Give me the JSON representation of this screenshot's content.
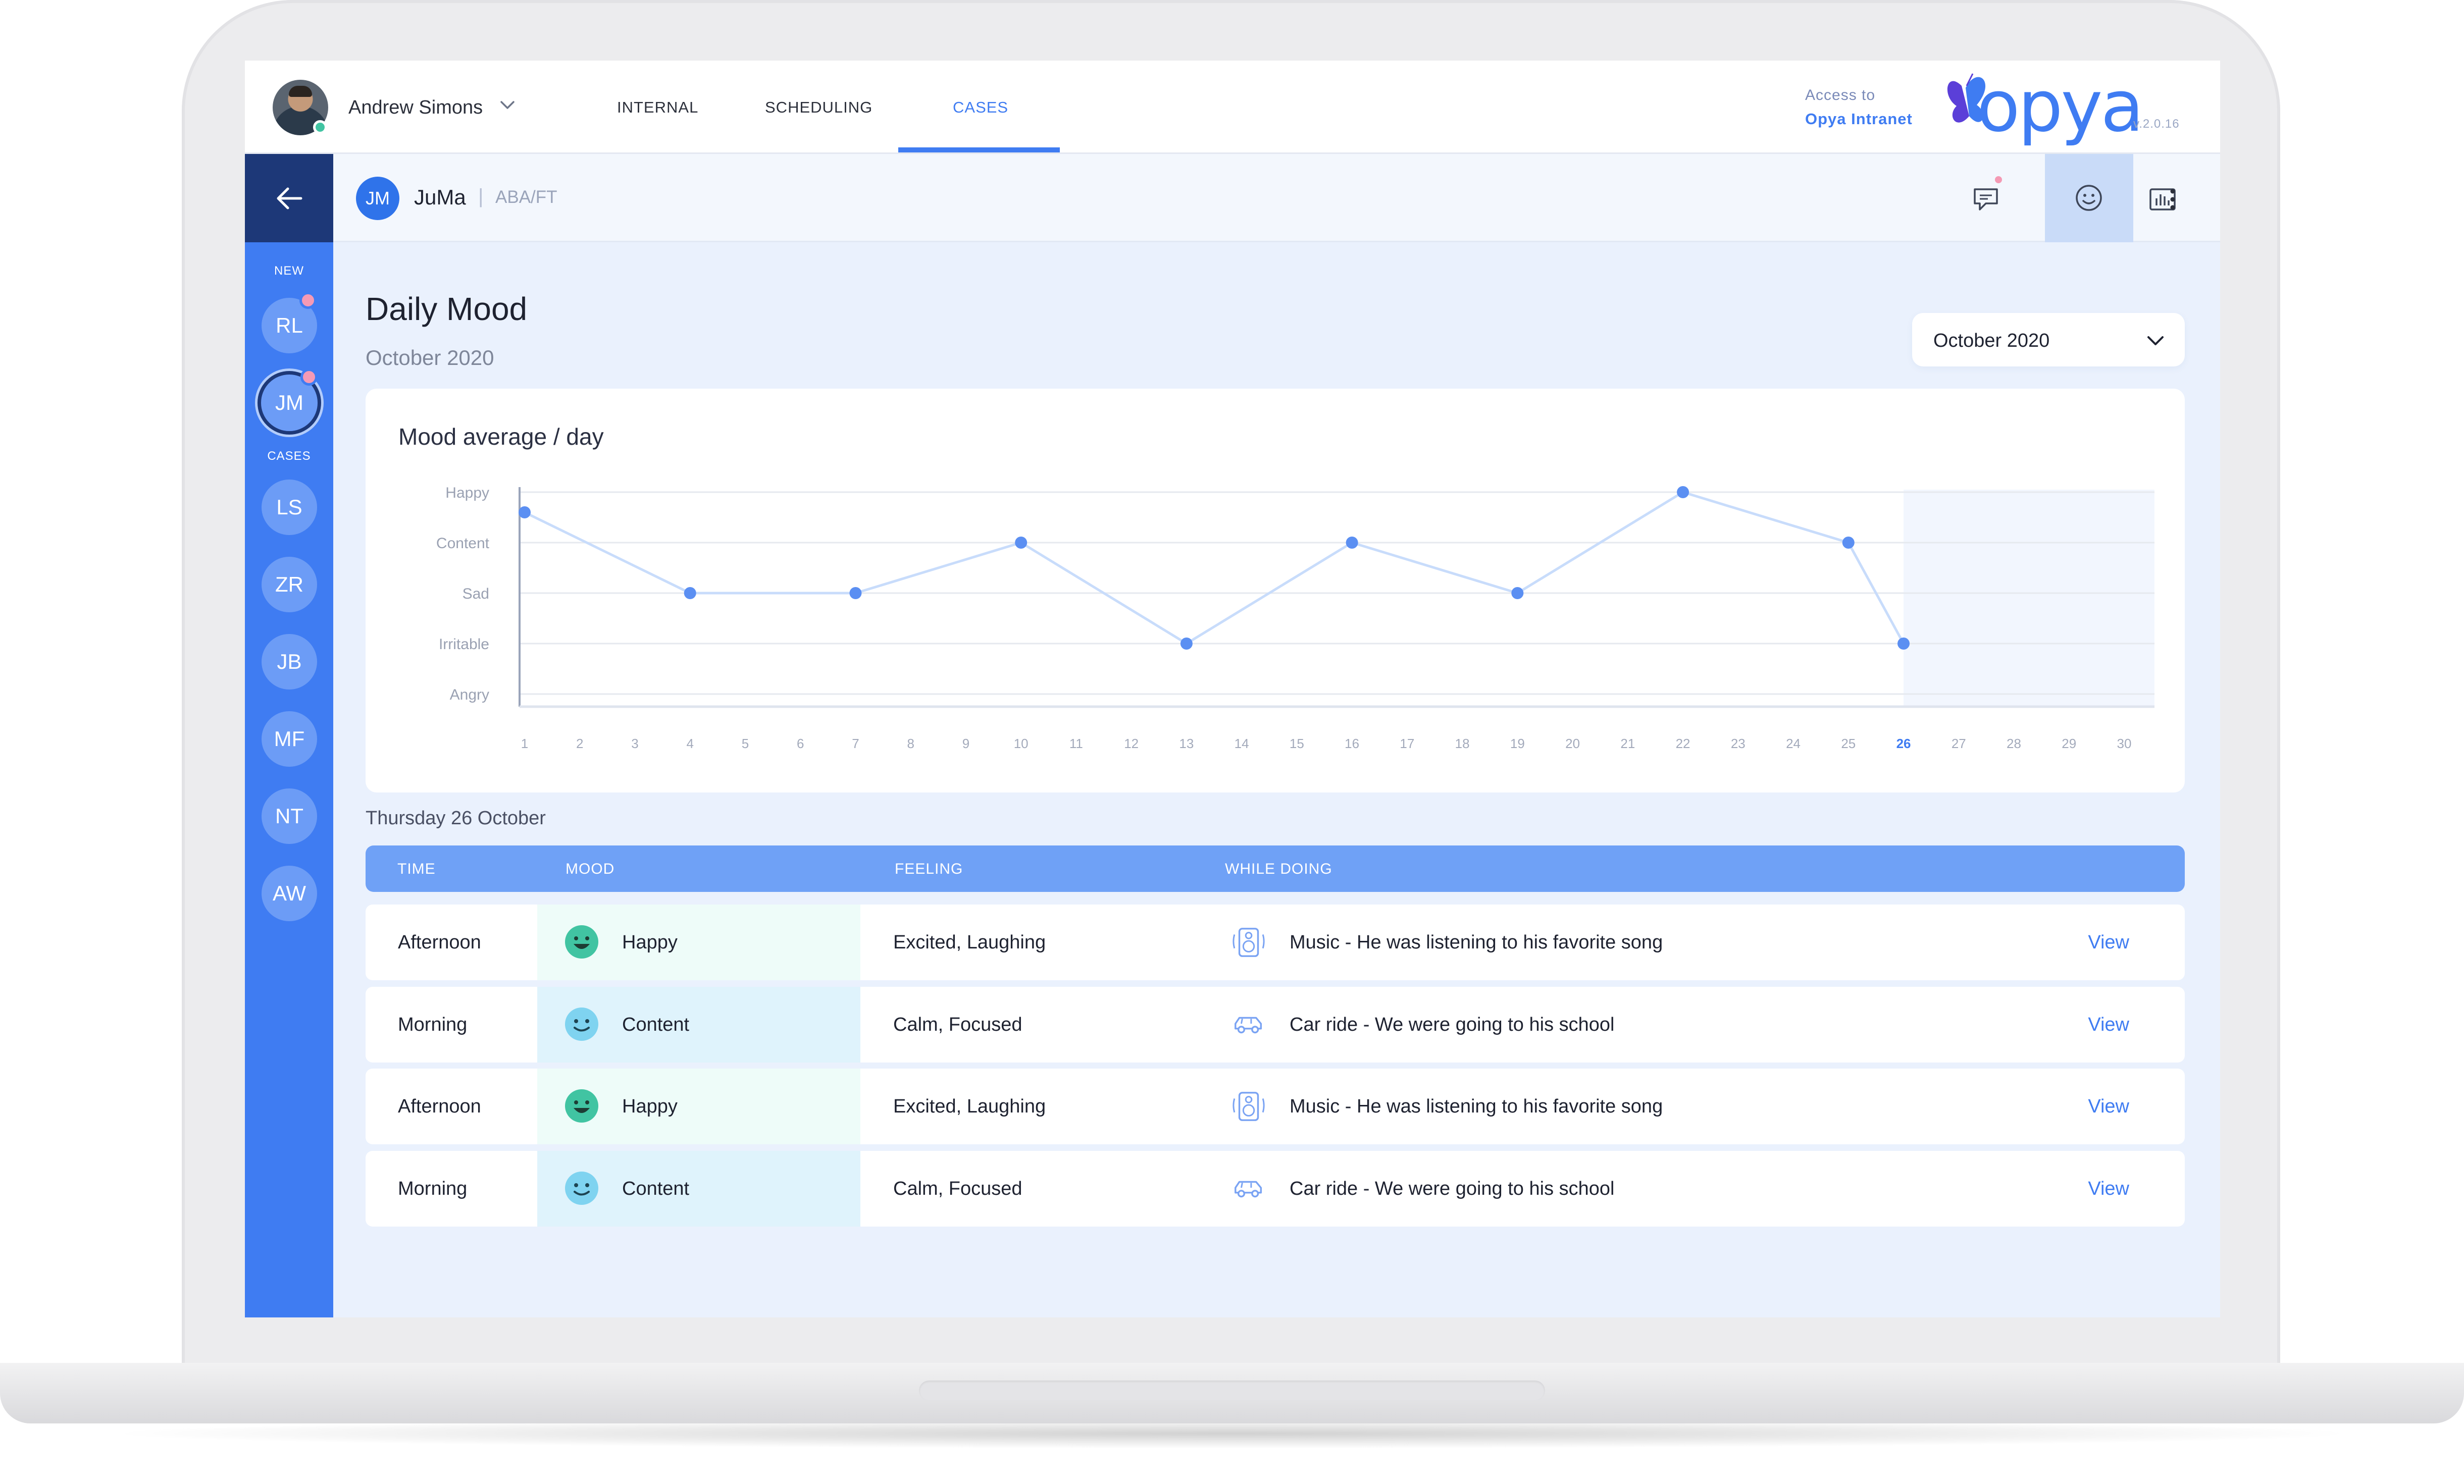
{
  "header": {
    "user_name": "Andrew Simons",
    "tabs": [
      {
        "label": "INTERNAL"
      },
      {
        "label": "SCHEDULING"
      },
      {
        "label": "CASES"
      }
    ],
    "access_label": "Access to",
    "access_link": "Opya Intranet",
    "logo_text": "opya",
    "version": "v.2.0.16"
  },
  "case": {
    "initials": "JM",
    "name": "JuMa",
    "separator": "|",
    "tag": "ABA/FT"
  },
  "toolbar": {
    "icons": [
      "chat-icon",
      "alert-icon",
      "stats-icon",
      "folder-icon",
      "smiley-icon",
      "more-icon"
    ]
  },
  "sidebar": {
    "new_label": "NEW",
    "cases_label": "CASES",
    "items": [
      {
        "initials": "RL"
      },
      {
        "initials": "JM"
      },
      {
        "initials": "LS"
      },
      {
        "initials": "ZR"
      },
      {
        "initials": "JB"
      },
      {
        "initials": "MF"
      },
      {
        "initials": "NT"
      },
      {
        "initials": "AW"
      }
    ]
  },
  "page": {
    "title": "Daily Mood",
    "subtitle": "October 2020",
    "month_select": "October 2020"
  },
  "chart_data": {
    "type": "line",
    "title": "Mood average / day",
    "y_categories": [
      "Angry",
      "Irritable",
      "Sad",
      "Content",
      "Happy"
    ],
    "x": [
      "1",
      "2",
      "3",
      "4",
      "5",
      "6",
      "7",
      "8",
      "9",
      "10",
      "11",
      "12",
      "13",
      "14",
      "15",
      "16",
      "17",
      "18",
      "19",
      "20",
      "21",
      "22",
      "23",
      "24",
      "25",
      "26",
      "27",
      "28",
      "29",
      "30"
    ],
    "highlight_day": "26",
    "points": [
      {
        "x": 1,
        "y": 4.6
      },
      {
        "x": 4,
        "y": 3
      },
      {
        "x": 7,
        "y": 3
      },
      {
        "x": 10,
        "y": 4
      },
      {
        "x": 13,
        "y": 2
      },
      {
        "x": 16,
        "y": 4
      },
      {
        "x": 19,
        "y": 3
      },
      {
        "x": 22,
        "y": 5
      },
      {
        "x": 25,
        "y": 4
      },
      {
        "x": 26,
        "y": 2
      }
    ],
    "colors": {
      "line": "#c8dcfb",
      "point": "#5b8ff2",
      "grid": "#e6e9ef",
      "future_shade": "#f2f6fe"
    }
  },
  "detail": {
    "day_label": "Thursday 26 October",
    "columns": [
      "TIME",
      "MOOD",
      "FEELING",
      "WHILE DOING"
    ],
    "rows": [
      {
        "time": "Afternoon",
        "mood": "Happy",
        "feeling": "Excited, Laughing",
        "doing": "Music - He was listening to his favorite song",
        "doing_icon": "speaker-icon",
        "action": "View"
      },
      {
        "time": "Morning",
        "mood": "Content",
        "feeling": "Calm, Focused",
        "doing": "Car ride - We were going to his school",
        "doing_icon": "car-icon",
        "action": "View"
      },
      {
        "time": "Afternoon",
        "mood": "Happy",
        "feeling": "Excited, Laughing",
        "doing": "Music - He was listening to his favorite song",
        "doing_icon": "speaker-icon",
        "action": "View"
      },
      {
        "time": "Morning",
        "mood": "Content",
        "feeling": "Calm, Focused",
        "doing": "Car ride - We were going to his school",
        "doing_icon": "car-icon",
        "action": "View"
      }
    ]
  },
  "colors": {
    "accent": "#3f7cf2",
    "navy": "#1d3878",
    "happy_face": "#41c4a2",
    "content_face": "#7fd3f0",
    "notification": "#f49ab4"
  }
}
